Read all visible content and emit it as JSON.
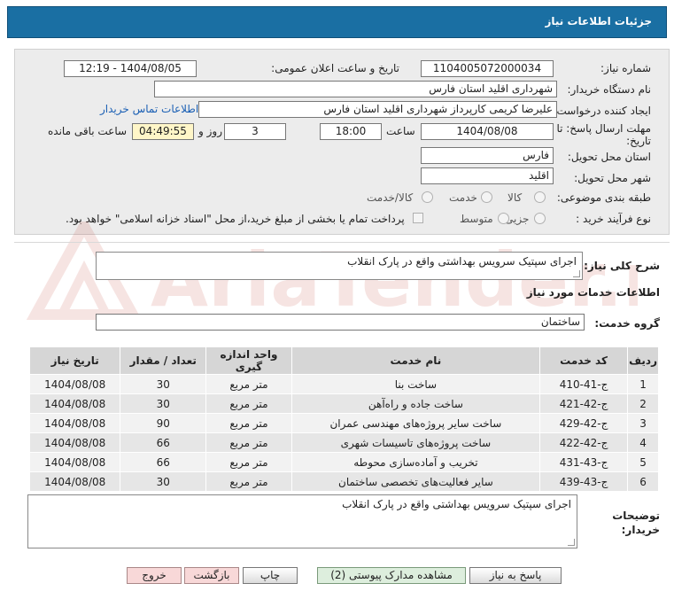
{
  "title": "جزئیات اطلاعات نیاز",
  "fields": {
    "need_number_label": "شماره نیاز:",
    "need_number": "1104005072000034",
    "announce_label": "تاریخ و ساعت اعلان عمومی:",
    "announce_value": "1404/08/05 - 12:19",
    "buyer_org_label": "نام دستگاه خریدار:",
    "buyer_org": "شهرداری اقلید استان فارس",
    "requester_label": "ایجاد کننده درخواست:",
    "requester": "علیرضا کریمی  کارپرداز شهرداری اقلید استان فارس",
    "contact_link": "اطلاعات تماس خریدار",
    "deadline_label_1": "مهلت ارسال پاسخ: تا",
    "deadline_label_2": "تاریخ:",
    "deadline_date": "1404/08/08",
    "time_label": "ساعت",
    "deadline_time": "18:00",
    "days_value": "3",
    "days_label": "روز و",
    "remaining_time": "04:49:55",
    "remaining_label": "ساعت باقی مانده",
    "province_label": "استان محل تحویل:",
    "province": "فارس",
    "city_label": "شهر محل تحویل:",
    "city": "اقلید",
    "category_label": "طبقه بندی موضوعی:",
    "category_options": [
      "کالا",
      "خدمت",
      "کالا/خدمت"
    ],
    "purchase_type_label": "نوع فرآیند خرید :",
    "purchase_type_options": [
      "جزیی",
      "متوسط"
    ],
    "payment_note": "پرداخت تمام یا بخشی از مبلغ خرید،از محل \"اسناد خزانه اسلامی\" خواهد بود."
  },
  "summary_label": "شرح کلی نیاز:",
  "summary": "اجرای سپتیک سرویس بهداشتی واقع در پارک انقلاب",
  "services_heading": "اطلاعات خدمات مورد نیاز",
  "service_group_label": "گروه خدمت:",
  "service_group": "ساختمان",
  "table": {
    "headers": [
      "ردیف",
      "کد خدمت",
      "نام خدمت",
      "واحد اندازه گیری",
      "تعداد / مقدار",
      "تاریخ نیاز"
    ],
    "rows": [
      [
        "1",
        "ج-41-410",
        "ساخت بنا",
        "متر مربع",
        "30",
        "1404/08/08"
      ],
      [
        "2",
        "ج-42-421",
        "ساخت جاده و راه‌آهن",
        "متر مربع",
        "30",
        "1404/08/08"
      ],
      [
        "3",
        "ج-42-429",
        "ساخت سایر پروژه‌های مهندسی عمران",
        "متر مربع",
        "90",
        "1404/08/08"
      ],
      [
        "4",
        "ج-42-422",
        "ساخت پروژه‌های تاسیسات شهری",
        "متر مربع",
        "66",
        "1404/08/08"
      ],
      [
        "5",
        "ج-43-431",
        "تخریب و آماده‌سازی محوطه",
        "متر مربع",
        "66",
        "1404/08/08"
      ],
      [
        "6",
        "ج-43-439",
        "سایر فعالیت‌های تخصصی ساختمان",
        "متر مربع",
        "30",
        "1404/08/08"
      ]
    ]
  },
  "buyer_notes_label_1": "توضیحات",
  "buyer_notes_label_2": "خریدار:",
  "buyer_notes": "اجرای سپتیک سرویس بهداشتی واقع در پارک انقلاب",
  "buttons": {
    "reply": "پاسخ به نیاز",
    "attachments": "مشاهده مدارک پیوستی (2)",
    "print": "چاپ",
    "back": "بازگشت",
    "exit": "خروج"
  },
  "watermark_text": "AriaTender.neT",
  "colors": {
    "titlebar": "#1a6fa3",
    "link": "#1a5fb4",
    "watermark": "#c0392b"
  }
}
